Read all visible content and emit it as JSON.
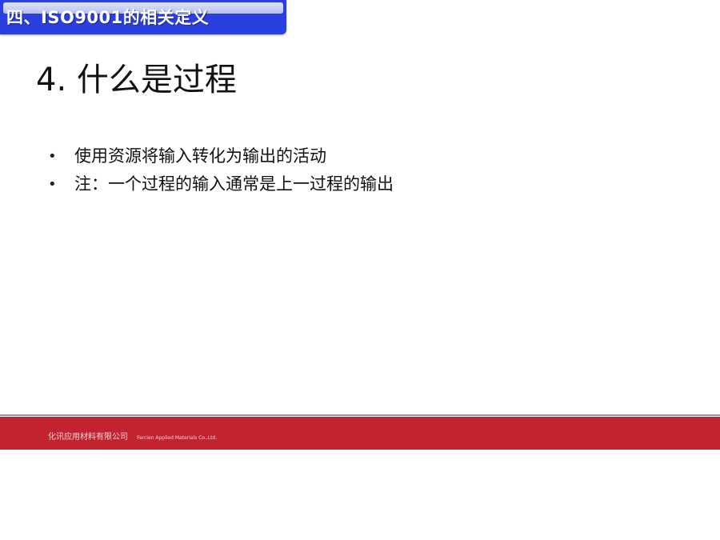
{
  "header": {
    "section_label": "四、ISO9001的相关定义"
  },
  "slide": {
    "title": "4. 什么是过程",
    "bullets": [
      "使用资源将输入转化为输出的活动",
      "注：一个过程的输入通常是上一过程的输出"
    ],
    "bullet_symbol": "•"
  },
  "footer": {
    "company_cn": "化讯应用材料有限公司",
    "company_en": "Farcien Applied Materials Co.,Ltd."
  },
  "colors": {
    "section_tab": "#2a3fe0",
    "footer_bar": "#c2232f"
  }
}
